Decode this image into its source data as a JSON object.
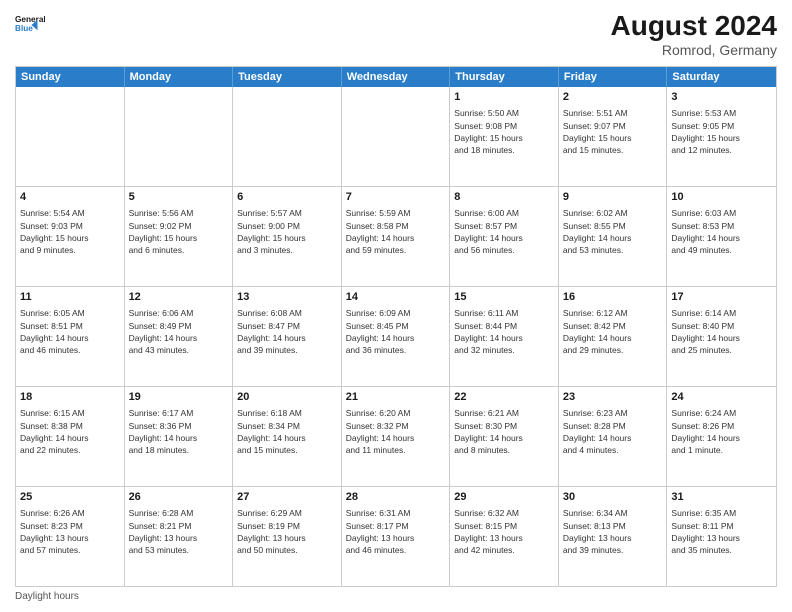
{
  "header": {
    "logo_line1": "General",
    "logo_line2": "Blue",
    "month": "August 2024",
    "location": "Romrod, Germany"
  },
  "days_of_week": [
    "Sunday",
    "Monday",
    "Tuesday",
    "Wednesday",
    "Thursday",
    "Friday",
    "Saturday"
  ],
  "footer": "Daylight hours",
  "weeks": [
    [
      {
        "day": "",
        "info": ""
      },
      {
        "day": "",
        "info": ""
      },
      {
        "day": "",
        "info": ""
      },
      {
        "day": "",
        "info": ""
      },
      {
        "day": "1",
        "info": "Sunrise: 5:50 AM\nSunset: 9:08 PM\nDaylight: 15 hours\nand 18 minutes."
      },
      {
        "day": "2",
        "info": "Sunrise: 5:51 AM\nSunset: 9:07 PM\nDaylight: 15 hours\nand 15 minutes."
      },
      {
        "day": "3",
        "info": "Sunrise: 5:53 AM\nSunset: 9:05 PM\nDaylight: 15 hours\nand 12 minutes."
      }
    ],
    [
      {
        "day": "4",
        "info": "Sunrise: 5:54 AM\nSunset: 9:03 PM\nDaylight: 15 hours\nand 9 minutes."
      },
      {
        "day": "5",
        "info": "Sunrise: 5:56 AM\nSunset: 9:02 PM\nDaylight: 15 hours\nand 6 minutes."
      },
      {
        "day": "6",
        "info": "Sunrise: 5:57 AM\nSunset: 9:00 PM\nDaylight: 15 hours\nand 3 minutes."
      },
      {
        "day": "7",
        "info": "Sunrise: 5:59 AM\nSunset: 8:58 PM\nDaylight: 14 hours\nand 59 minutes."
      },
      {
        "day": "8",
        "info": "Sunrise: 6:00 AM\nSunset: 8:57 PM\nDaylight: 14 hours\nand 56 minutes."
      },
      {
        "day": "9",
        "info": "Sunrise: 6:02 AM\nSunset: 8:55 PM\nDaylight: 14 hours\nand 53 minutes."
      },
      {
        "day": "10",
        "info": "Sunrise: 6:03 AM\nSunset: 8:53 PM\nDaylight: 14 hours\nand 49 minutes."
      }
    ],
    [
      {
        "day": "11",
        "info": "Sunrise: 6:05 AM\nSunset: 8:51 PM\nDaylight: 14 hours\nand 46 minutes."
      },
      {
        "day": "12",
        "info": "Sunrise: 6:06 AM\nSunset: 8:49 PM\nDaylight: 14 hours\nand 43 minutes."
      },
      {
        "day": "13",
        "info": "Sunrise: 6:08 AM\nSunset: 8:47 PM\nDaylight: 14 hours\nand 39 minutes."
      },
      {
        "day": "14",
        "info": "Sunrise: 6:09 AM\nSunset: 8:45 PM\nDaylight: 14 hours\nand 36 minutes."
      },
      {
        "day": "15",
        "info": "Sunrise: 6:11 AM\nSunset: 8:44 PM\nDaylight: 14 hours\nand 32 minutes."
      },
      {
        "day": "16",
        "info": "Sunrise: 6:12 AM\nSunset: 8:42 PM\nDaylight: 14 hours\nand 29 minutes."
      },
      {
        "day": "17",
        "info": "Sunrise: 6:14 AM\nSunset: 8:40 PM\nDaylight: 14 hours\nand 25 minutes."
      }
    ],
    [
      {
        "day": "18",
        "info": "Sunrise: 6:15 AM\nSunset: 8:38 PM\nDaylight: 14 hours\nand 22 minutes."
      },
      {
        "day": "19",
        "info": "Sunrise: 6:17 AM\nSunset: 8:36 PM\nDaylight: 14 hours\nand 18 minutes."
      },
      {
        "day": "20",
        "info": "Sunrise: 6:18 AM\nSunset: 8:34 PM\nDaylight: 14 hours\nand 15 minutes."
      },
      {
        "day": "21",
        "info": "Sunrise: 6:20 AM\nSunset: 8:32 PM\nDaylight: 14 hours\nand 11 minutes."
      },
      {
        "day": "22",
        "info": "Sunrise: 6:21 AM\nSunset: 8:30 PM\nDaylight: 14 hours\nand 8 minutes."
      },
      {
        "day": "23",
        "info": "Sunrise: 6:23 AM\nSunset: 8:28 PM\nDaylight: 14 hours\nand 4 minutes."
      },
      {
        "day": "24",
        "info": "Sunrise: 6:24 AM\nSunset: 8:26 PM\nDaylight: 14 hours\nand 1 minute."
      }
    ],
    [
      {
        "day": "25",
        "info": "Sunrise: 6:26 AM\nSunset: 8:23 PM\nDaylight: 13 hours\nand 57 minutes."
      },
      {
        "day": "26",
        "info": "Sunrise: 6:28 AM\nSunset: 8:21 PM\nDaylight: 13 hours\nand 53 minutes."
      },
      {
        "day": "27",
        "info": "Sunrise: 6:29 AM\nSunset: 8:19 PM\nDaylight: 13 hours\nand 50 minutes."
      },
      {
        "day": "28",
        "info": "Sunrise: 6:31 AM\nSunset: 8:17 PM\nDaylight: 13 hours\nand 46 minutes."
      },
      {
        "day": "29",
        "info": "Sunrise: 6:32 AM\nSunset: 8:15 PM\nDaylight: 13 hours\nand 42 minutes."
      },
      {
        "day": "30",
        "info": "Sunrise: 6:34 AM\nSunset: 8:13 PM\nDaylight: 13 hours\nand 39 minutes."
      },
      {
        "day": "31",
        "info": "Sunrise: 6:35 AM\nSunset: 8:11 PM\nDaylight: 13 hours\nand 35 minutes."
      }
    ]
  ]
}
